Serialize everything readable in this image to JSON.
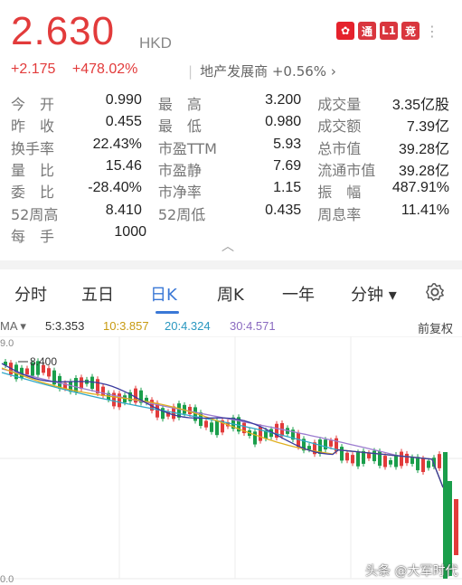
{
  "quote": {
    "price": "2.630",
    "currency": "HKD",
    "change": "+2.175",
    "change_pct": "+478.02%",
    "sector": "地产发展商 +0.56% ›",
    "badges": [
      "通",
      "L1",
      "竞"
    ],
    "more": "⋮"
  },
  "stats": [
    [
      {
        "label": "今　开",
        "value": "0.990"
      },
      {
        "label": "最　高",
        "value": "3.200"
      },
      {
        "label": "成交量",
        "value": "3.35亿股"
      }
    ],
    [
      {
        "label": "昨　收",
        "value": "0.455"
      },
      {
        "label": "最　低",
        "value": "0.980"
      },
      {
        "label": "成交额",
        "value": "7.39亿"
      }
    ],
    [
      {
        "label": "换手率",
        "value": "22.43%"
      },
      {
        "label": "市盈TTM",
        "value": "5.93"
      },
      {
        "label": "总市值",
        "value": "39.28亿"
      }
    ],
    [
      {
        "label": "量　比",
        "value": "15.46"
      },
      {
        "label": "市盈静",
        "value": "7.69"
      },
      {
        "label": "流通市值",
        "value": "39.28亿"
      }
    ],
    [
      {
        "label": "委　比",
        "value": "-28.40%"
      },
      {
        "label": "市净率",
        "value": "1.15"
      },
      {
        "label": "振　幅",
        "value": "487.91%"
      }
    ],
    [
      {
        "label": "52周高",
        "value": "8.410"
      },
      {
        "label": "52周低",
        "value": "0.435"
      },
      {
        "label": "周息率",
        "value": "11.41%"
      }
    ],
    [
      {
        "label": "每　手",
        "value": "1000"
      }
    ]
  ],
  "tabs": [
    "分时",
    "五日",
    "日K",
    "周K",
    "一年",
    "分钟 ▾"
  ],
  "active_tab": "日K",
  "ma": {
    "selector": "MA ▾",
    "ma5": "5:3.353",
    "ma10": "10:3.857",
    "ma20": "20:4.324",
    "ma30": "30:4.571",
    "adjust": "前复权"
  },
  "chart": {
    "top_value": "9.0",
    "bottom_value": "0.0",
    "high_label": "8.400"
  },
  "watermark": "头条 @大军时代",
  "colors": {
    "up": "#e23b3b",
    "down": "#1a9e4b",
    "ma5": "#3a3a9e",
    "ma10": "#e0b020",
    "ma20": "#30a8c8",
    "ma30": "#9c7cd0",
    "accent": "#3a78d6"
  }
}
